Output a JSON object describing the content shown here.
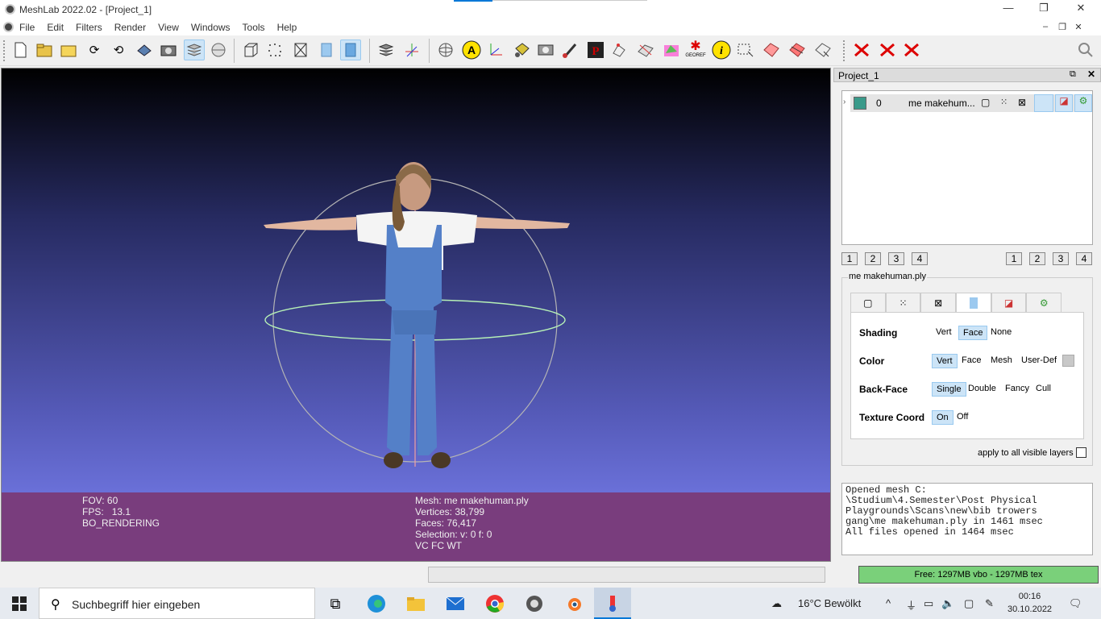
{
  "window": {
    "title": "MeshLab 2022.02 - [Project_1]",
    "controls": [
      "—",
      "❐",
      "✕"
    ]
  },
  "menu": {
    "items": [
      "File",
      "Edit",
      "Filters",
      "Render",
      "View",
      "Windows",
      "Tools",
      "Help"
    ],
    "mdi_controls": [
      "–",
      "❐",
      "✕"
    ]
  },
  "toolbar": {
    "icons": [
      "new-project-icon",
      "open-project-icon",
      "import-mesh-icon",
      "reload-icon",
      "reload-all-icon",
      "export-mesh-icon",
      "snapshot-icon",
      "layers-icon",
      "raster-icon",
      "bounding-box-icon",
      "points-icon",
      "wireframe-icon",
      "flat-icon",
      "smooth-icon",
      "show-layers-icon",
      "axis-icon",
      "trackball-icon",
      "annotation-icon",
      "measure-icon",
      "paint-bucket-icon",
      "raster-align-icon",
      "brush-icon",
      "pickpoints-icon",
      "select-vertex-icon",
      "mutual-correspondences-icon",
      "paint-icon",
      "georef-icon",
      "info-icon",
      "select-faces-icon",
      "select-connected-icon",
      "select-region-icon",
      "select-all-icon",
      "delete-faces-icon",
      "delete-vertices-icon",
      "delete-all-icon"
    ],
    "georef_label": "GEOREF"
  },
  "viewport": {
    "fov_label": "FOV: 60",
    "fps_label": "FPS:",
    "fps_value": "13.1",
    "rendering": "BO_RENDERING",
    "mesh": "Mesh: me makehuman.ply",
    "vertices": "Vertices: 38,799",
    "faces": "Faces: 76,417",
    "selection": "Selection: v: 0 f: 0",
    "attributes": "VC FC WT"
  },
  "panel": {
    "title": "Project_1",
    "layer": {
      "index": "0",
      "name": "me makehum..."
    },
    "num_buttons_left": [
      "1",
      "2",
      "3",
      "4"
    ],
    "num_buttons_right": [
      "1",
      "2",
      "3",
      "4"
    ],
    "mesh_name": "me makehuman.ply",
    "shading": {
      "label": "Shading",
      "options": [
        "Vert",
        "Face",
        "None"
      ],
      "selected": "Face"
    },
    "color": {
      "label": "Color",
      "options": [
        "Vert",
        "Face",
        "Mesh",
        "User-Def"
      ],
      "selected": "Vert"
    },
    "backface": {
      "label": "Back-Face",
      "options": [
        "Single",
        "Double",
        "Fancy",
        "Cull"
      ],
      "selected": "Single"
    },
    "texcoord": {
      "label": "Texture Coord",
      "options": [
        "On",
        "Off"
      ],
      "selected": "On"
    },
    "apply_all": "apply to all visible layers",
    "log": [
      "Opened mesh C:",
      "\\Studium\\4.Semester\\Post Physical",
      "Playgrounds\\Scans\\new\\bib trowers",
      "gang\\me makehuman.ply in 1461 msec",
      "All files opened in 1464 msec"
    ]
  },
  "status": {
    "memory": "Free: 1297MB vbo - 1297MB tex",
    "progress": 0
  },
  "taskbar": {
    "search_placeholder": "Suchbegriff hier eingeben",
    "weather": "16°C  Bewölkt",
    "time": "00:16",
    "date": "30.10.2022"
  }
}
